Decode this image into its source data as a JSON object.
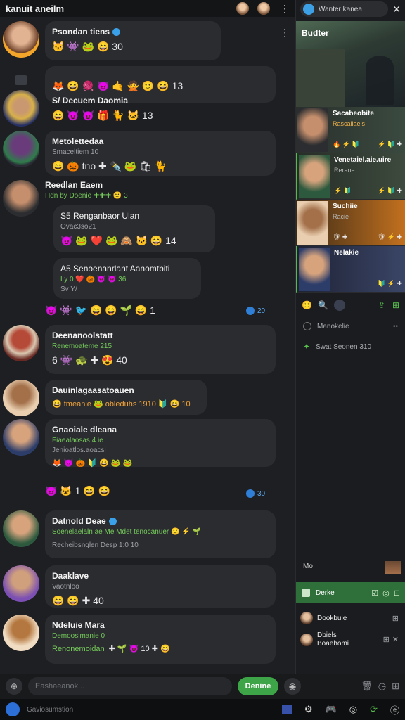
{
  "app": {
    "title": "kanuit aneilm"
  },
  "right_panel": {
    "header_chip": "Wanter kanea",
    "hero_title": "Budter",
    "cards": [
      {
        "title": "Sacabeobite",
        "sub": "Rascaliaeis",
        "icons": "🔥 ⚡ 🔰",
        "icons_right": "⚡ 🔰 ✚"
      },
      {
        "title": "Venetaiel.aie.uire",
        "sub": "Rerane",
        "icons": "⚡ 🔰",
        "icons_right": "⚡ 🔰 ✚"
      },
      {
        "title": "Suchiie",
        "sub": "Racie",
        "icons": "🛡 ✚",
        "icons_right": "🛡 ⚡ ✚"
      },
      {
        "title": "Nelakie",
        "sub": "",
        "icons": "",
        "icons_right": "🔰 ⚡ ✚"
      }
    ],
    "tools": {
      "icons": [
        "🙂",
        "🔍"
      ],
      "right": [
        "⇪",
        "⊞"
      ]
    },
    "rows": [
      {
        "label": "Manokelie",
        "icon": "clock"
      },
      {
        "label": "Swat Seonen 310",
        "icon": "cube"
      }
    ],
    "footer_label": "Mo",
    "pill_label": "Derke",
    "people": [
      {
        "name": "Dookbuie"
      },
      {
        "name": "Dbiels\nBoaehomi"
      }
    ]
  },
  "messages": [
    {
      "name": "Psondan tiens",
      "reacts": "🐱 👾 🐸 😄 30",
      "verified": true
    },
    {
      "name": "",
      "reacts": "🦊 😄 🧶 😈 🤙 🙅 🙂 😄 13",
      "note": "⁃⁃"
    },
    {
      "name": "S/ Decuem Daomia",
      "reacts": "😄 😈 😈 🎁 🐈 🐱 13",
      "verified": false,
      "meta": "0"
    },
    {
      "name": "Metolettedaa",
      "sub": "Smaceltiem 10",
      "reacts": "😄 🎃 tno ✚ ✒️ 🐸 🛍 🐈",
      "verified": false
    },
    {
      "name": "Reedlan Eaem",
      "sub": "Hdn by Doenie ✚✚✚ 🙂 3",
      "reacts": ""
    },
    {
      "name": "S5 Renganbaor Ulan",
      "sub": "Ovac3so21",
      "reacts": "😈 🐸 ❤️ 🐸 🙈 🐱 😄 14"
    },
    {
      "name": "A5 Senoenanrlant Aanomtbiti",
      "sub": "Ly 0 ❤️ 🎃 😈 😈 36",
      "sub2": "Sv Y/",
      "reacts": ""
    },
    {
      "name": "",
      "reacts": "😈 👾 🐦 😄 😄 🌱 😄 1",
      "meta": "20"
    },
    {
      "name": "Deenanoolstatt",
      "sub": "Renemoateme 215",
      "reacts": "6 👾 🐢 ✚ 😍 40"
    },
    {
      "name": "Dauinlagaasatoauen",
      "sub": "",
      "reacts": "😄 tmeanie 🐸 obleduhs 1910 🔰 😄 10"
    },
    {
      "name": "Gnaoiale dleana",
      "sub": "Fiaealaosas 4 ie",
      "sub2": "Jenioatlos.aoacsi",
      "reacts": "🦊 😈 🎃 🔰 😄 🐸 🐸"
    },
    {
      "name": "",
      "reacts": "😈 🐱 1 😄 😄",
      "meta": "30"
    },
    {
      "name": "Datnold Deae",
      "sub": "Soenelaelaln ae Me Mdet tenocanuer 🙂 ⚡ 🌱",
      "sub2": "Recheibsnglen Desp 1:0 10",
      "reacts": "",
      "verified": true
    },
    {
      "name": "Daaklave",
      "sub2": "Vaotnloo",
      "reacts": "😄 😄 ✚ 40"
    },
    {
      "name": "Ndeluie Mara",
      "sub": "Demoosimanie 0",
      "sub2": "Renonemoidan",
      "reacts": "✚ 🌱 😈 10 ✚ 😄"
    }
  ],
  "composer": {
    "placeholder": "Eashaeanok...",
    "send_label": "Denine"
  },
  "bottombar": {
    "text": "Gaviosumstion"
  }
}
